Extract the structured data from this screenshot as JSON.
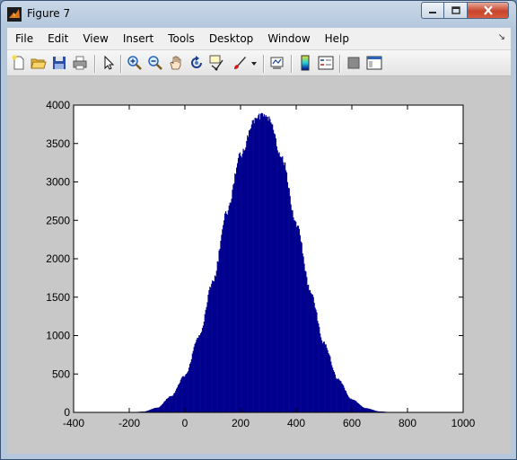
{
  "window": {
    "title": "Figure 7"
  },
  "menu": {
    "items": [
      "File",
      "Edit",
      "View",
      "Insert",
      "Tools",
      "Desktop",
      "Window",
      "Help"
    ]
  },
  "toolbar": {
    "icons": [
      "new-figure-icon",
      "open-file-icon",
      "save-icon",
      "print-icon",
      "edit-plot-arrow-icon",
      "zoom-in-icon",
      "zoom-out-icon",
      "pan-hand-icon",
      "rotate-3d-icon",
      "data-cursor-icon",
      "brush-icon",
      "brush-dropdown-icon",
      "link-plot-icon",
      "colorbar-icon",
      "legend-icon",
      "hide-plot-tools-icon",
      "show-plot-tools-icon"
    ]
  },
  "colors": {
    "bar_fill": "#00008f",
    "figure_bg": "#c8c8c8",
    "axes_bg": "#ffffff"
  },
  "chart_data": {
    "type": "bar",
    "title": "",
    "xlabel": "",
    "ylabel": "",
    "xlim": [
      -400,
      1000
    ],
    "ylim": [
      0,
      4000
    ],
    "x_ticks": [
      "-400",
      "-200",
      "0",
      "200",
      "400",
      "600",
      "800",
      "1000"
    ],
    "y_ticks": [
      "0",
      "500",
      "1000",
      "1500",
      "2000",
      "2500",
      "3000",
      "3500",
      "4000"
    ],
    "grid": false,
    "histogram": {
      "description_of_values": "counts per bin",
      "x": [
        -200,
        -150,
        -100,
        -50,
        0,
        50,
        100,
        150,
        200,
        250,
        280,
        300,
        350,
        400,
        450,
        500,
        550,
        600,
        650,
        700,
        750
      ],
      "values": [
        0,
        10,
        60,
        210,
        480,
        980,
        1700,
        2600,
        3350,
        3800,
        3880,
        3820,
        3300,
        2450,
        1600,
        900,
        430,
        170,
        55,
        12,
        0
      ]
    }
  }
}
